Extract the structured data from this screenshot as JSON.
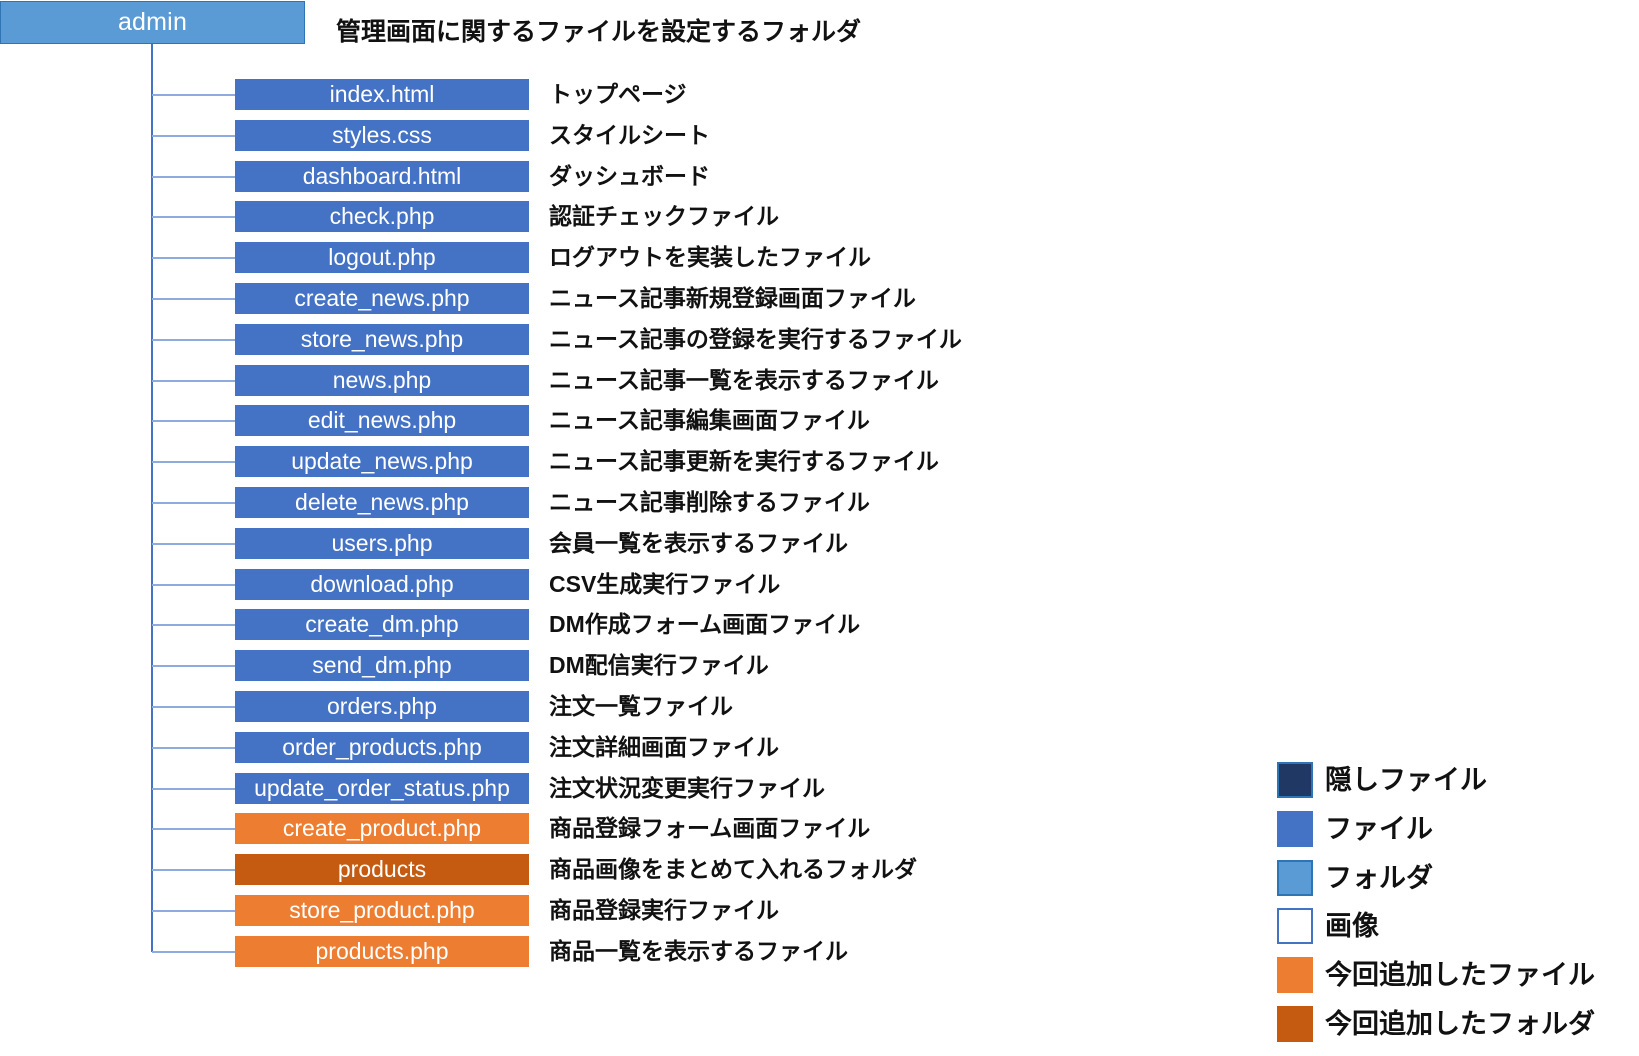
{
  "diagram": {
    "root": {
      "label": "admin",
      "description": "管理画面に関するファイルを設定するフォルダ",
      "kind": "folder",
      "color": "#5B9BD5"
    },
    "colors": {
      "hidden_file": "#1F3864",
      "file": "#4472C4",
      "folder": "#5B9BD5",
      "image": "#FFFFFF",
      "image_border": "#4472C4",
      "new_file": "#ED7D31",
      "new_folder": "#C55A11",
      "connector": "#8FAADC",
      "trunk": "#4472C4",
      "text_dark": "#111111",
      "text_light": "#FFFFFF"
    },
    "nodes": [
      {
        "name": "index.html",
        "description": "トップページ",
        "kind": "file",
        "color": "#4472C4"
      },
      {
        "name": "styles.css",
        "description": "スタイルシート",
        "kind": "file",
        "color": "#4472C4"
      },
      {
        "name": "dashboard.html",
        "description": "ダッシュボード",
        "kind": "file",
        "color": "#4472C4"
      },
      {
        "name": "check.php",
        "description": "認証チェックファイル",
        "kind": "file",
        "color": "#4472C4"
      },
      {
        "name": "logout.php",
        "description": "ログアウトを実装したファイル",
        "kind": "file",
        "color": "#4472C4"
      },
      {
        "name": "create_news.php",
        "description": "ニュース記事新規登録画面ファイル",
        "kind": "file",
        "color": "#4472C4"
      },
      {
        "name": "store_news.php",
        "description": "ニュース記事の登録を実行するファイル",
        "kind": "file",
        "color": "#4472C4"
      },
      {
        "name": "news.php",
        "description": "ニュース記事一覧を表示するファイル",
        "kind": "file",
        "color": "#4472C4"
      },
      {
        "name": "edit_news.php",
        "description": "ニュース記事編集画面ファイル",
        "kind": "file",
        "color": "#4472C4"
      },
      {
        "name": "update_news.php",
        "description": "ニュース記事更新を実行するファイル",
        "kind": "file",
        "color": "#4472C4"
      },
      {
        "name": "delete_news.php",
        "description": "ニュース記事削除するファイル",
        "kind": "file",
        "color": "#4472C4"
      },
      {
        "name": "users.php",
        "description": "会員一覧を表示するファイル",
        "kind": "file",
        "color": "#4472C4"
      },
      {
        "name": "download.php",
        "description": "CSV生成実行ファイル",
        "kind": "file",
        "color": "#4472C4"
      },
      {
        "name": "create_dm.php",
        "description": "DM作成フォーム画面ファイル",
        "kind": "file",
        "color": "#4472C4"
      },
      {
        "name": "send_dm.php",
        "description": "DM配信実行ファイル",
        "kind": "file",
        "color": "#4472C4"
      },
      {
        "name": "orders.php",
        "description": "注文一覧ファイル",
        "kind": "file",
        "color": "#4472C4"
      },
      {
        "name": "order_products.php",
        "description": "注文詳細画面ファイル",
        "kind": "file",
        "color": "#4472C4"
      },
      {
        "name": "update_order_status.php",
        "description": "注文状況変更実行ファイル",
        "kind": "file",
        "color": "#4472C4"
      },
      {
        "name": "create_product.php",
        "description": "商品登録フォーム画面ファイル",
        "kind": "new-file",
        "color": "#ED7D31"
      },
      {
        "name": "products",
        "description": "商品画像をまとめて入れるフォルダ",
        "kind": "new-folder",
        "color": "#C55A11"
      },
      {
        "name": "store_product.php",
        "description": "商品登録実行ファイル",
        "kind": "new-file",
        "color": "#ED7D31"
      },
      {
        "name": "products.php",
        "description": "商品一覧を表示するファイル",
        "kind": "new-file",
        "color": "#ED7D31"
      }
    ],
    "legend": [
      {
        "label": "隠しファイル",
        "color": "#1F3864",
        "border": "#2E75B6"
      },
      {
        "label": "ファイル",
        "color": "#4472C4",
        "border": "#4472C4"
      },
      {
        "label": "フォルダ",
        "color": "#5B9BD5",
        "border": "#2E75B6"
      },
      {
        "label": "画像",
        "color": "#FFFFFF",
        "border": "#4472C4"
      },
      {
        "label": "今回追加したファイル",
        "color": "#ED7D31",
        "border": "#ED7D31"
      },
      {
        "label": "今回追加したフォルダ",
        "color": "#C55A11",
        "border": "#C55A11"
      }
    ]
  }
}
